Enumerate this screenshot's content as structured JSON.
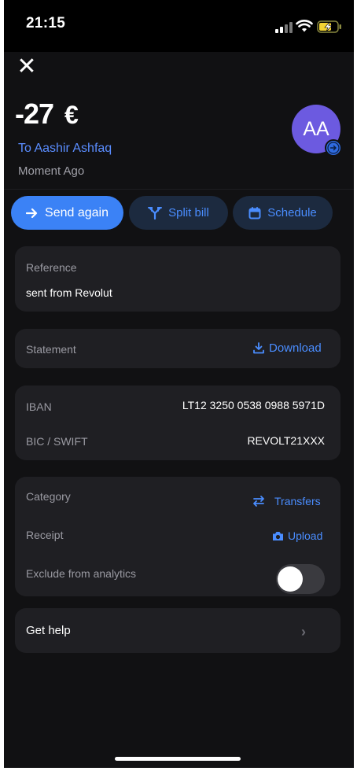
{
  "status_bar": {
    "time": "21:15"
  },
  "header": {
    "amount": "-27",
    "currency": "€",
    "recipient": "To Aashir Ashfaq",
    "timestamp": "Moment Ago",
    "avatar_initials": "AA"
  },
  "actions": {
    "send_again": "Send again",
    "split_bill": "Split bill",
    "schedule": "Schedule"
  },
  "reference": {
    "label": "Reference",
    "value": "sent from Revolut"
  },
  "statement": {
    "label": "Statement",
    "download": "Download"
  },
  "bank": {
    "iban_label": "IBAN",
    "iban_value": "LT12 3250 0538 0988 5971D",
    "bic_label": "BIC / SWIFT",
    "bic_value": "REVOLT21XXX"
  },
  "details": {
    "category_label": "Category",
    "category_value": "Transfers",
    "receipt_label": "Receipt",
    "receipt_action": "Upload",
    "exclude_label": "Exclude from analytics",
    "exclude_enabled": false
  },
  "help": {
    "label": "Get help"
  },
  "colors": {
    "accent": "#3b82f6",
    "link": "#4a8dff",
    "avatar": "#6c5ae0",
    "card": "#1f1f23",
    "background": "#111113"
  }
}
